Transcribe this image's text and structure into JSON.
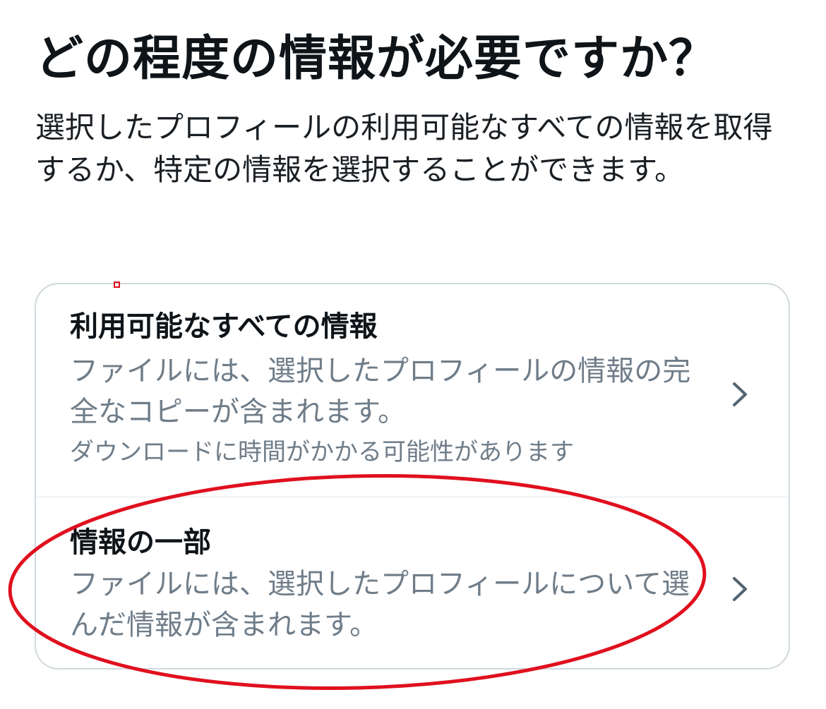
{
  "header": {
    "title": "どの程度の情報が必要ですか？",
    "description": "選択したプロフィールの利用可能なすべての情報を取得するか、特定の情報を選択することができます。"
  },
  "options": [
    {
      "title": "利用可能なすべての情報",
      "description": "ファイルには、選択したプロフィールの情報の完全なコピーが含まれます。",
      "note": "ダウンロードに時間がかかる可能性があります",
      "icon": "chevron-right-icon"
    },
    {
      "title": "情報の一部",
      "description": "ファイルには、選択したプロフィールについて選んだ情報が含まれます。",
      "icon": "chevron-right-icon"
    }
  ],
  "colors": {
    "text_primary": "#0f1419",
    "text_secondary": "#6f7d89",
    "card_border": "#cfd9de",
    "annotation": "#e0101e"
  }
}
